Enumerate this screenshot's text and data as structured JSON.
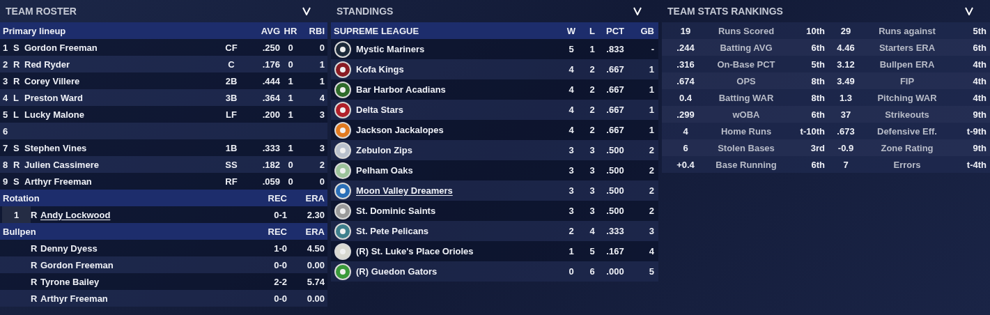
{
  "roster": {
    "title": "TEAM ROSTER",
    "lineup": {
      "heading": "Primary lineup",
      "columns": [
        "AVG",
        "HR",
        "RBI"
      ],
      "batters": [
        {
          "order": "1",
          "bats": "S",
          "name": "Gordon Freeman",
          "position": "CF",
          "avg": ".250",
          "hr": "0",
          "rbi": "0"
        },
        {
          "order": "2",
          "bats": "R",
          "name": "Red Ryder",
          "position": "C",
          "avg": ".176",
          "hr": "0",
          "rbi": "1"
        },
        {
          "order": "3",
          "bats": "R",
          "name": "Corey Villere",
          "position": "2B",
          "avg": ".444",
          "hr": "1",
          "rbi": "1"
        },
        {
          "order": "4",
          "bats": "L",
          "name": "Preston Ward",
          "position": "3B",
          "avg": ".364",
          "hr": "1",
          "rbi": "4"
        },
        {
          "order": "5",
          "bats": "L",
          "name": "Lucky Malone",
          "position": "LF",
          "avg": ".200",
          "hr": "1",
          "rbi": "3"
        },
        {
          "order": "6"
        },
        {
          "order": "7",
          "bats": "S",
          "name": "Stephen Vines",
          "position": "1B",
          "avg": ".333",
          "hr": "1",
          "rbi": "3"
        },
        {
          "order": "8",
          "bats": "R",
          "name": "Julien Cassimere",
          "position": "SS",
          "avg": ".182",
          "hr": "0",
          "rbi": "2"
        },
        {
          "order": "9",
          "bats": "S",
          "name": "Arthyr Freeman",
          "position": "RF",
          "avg": ".059",
          "hr": "0",
          "rbi": "0"
        }
      ]
    },
    "rotation": {
      "heading": "Rotation",
      "columns": [
        "REC",
        "ERA"
      ],
      "pitchers": [
        {
          "slot": "1",
          "throws": "R",
          "name": "Andy Lockwood",
          "record": "0-1",
          "era": "2.30",
          "highlighted": true
        }
      ]
    },
    "bullpen": {
      "heading": "Bullpen",
      "columns": [
        "REC",
        "ERA"
      ],
      "pitchers": [
        {
          "throws": "R",
          "name": "Denny Dyess",
          "record": "1-0",
          "era": "4.50",
          "highlighted": false
        },
        {
          "throws": "R",
          "name": "Gordon Freeman",
          "record": "0-0",
          "era": "0.00",
          "highlighted": false
        },
        {
          "throws": "R",
          "name": "Tyrone Bailey",
          "record": "2-2",
          "era": "5.74",
          "highlighted": false
        },
        {
          "throws": "R",
          "name": "Arthyr Freeman",
          "record": "0-0",
          "era": "0.00",
          "highlighted": false
        }
      ]
    }
  },
  "standings": {
    "title": "STANDINGS",
    "league": "SUPREME LEAGUE",
    "columns": [
      "W",
      "L",
      "PCT",
      "GB"
    ],
    "teams": [
      {
        "name": "Mystic Mariners",
        "w": "5",
        "l": "1",
        "pct": ".833",
        "gb": "-",
        "color": "#1c2a3a",
        "highlighted": false
      },
      {
        "name": "Kofa Kings",
        "w": "4",
        "l": "2",
        "pct": ".667",
        "gb": "1",
        "color": "#8a1c24",
        "highlighted": false
      },
      {
        "name": "Bar Harbor Acadians",
        "w": "4",
        "l": "2",
        "pct": ".667",
        "gb": "1",
        "color": "#2e6b2a",
        "highlighted": false
      },
      {
        "name": "Delta Stars",
        "w": "4",
        "l": "2",
        "pct": ".667",
        "gb": "1",
        "color": "#b0202a",
        "highlighted": false
      },
      {
        "name": "Jackson Jackalopes",
        "w": "4",
        "l": "2",
        "pct": ".667",
        "gb": "1",
        "color": "#e07a20",
        "highlighted": false
      },
      {
        "name": "Zebulon Zips",
        "w": "3",
        "l": "3",
        "pct": ".500",
        "gb": "2",
        "color": "#b8c0cc",
        "highlighted": false
      },
      {
        "name": "Pelham Oaks",
        "w": "3",
        "l": "3",
        "pct": ".500",
        "gb": "2",
        "color": "#9cc29a",
        "highlighted": false
      },
      {
        "name": "Moon Valley Dreamers",
        "w": "3",
        "l": "3",
        "pct": ".500",
        "gb": "2",
        "color": "#2a6fb8",
        "highlighted": true
      },
      {
        "name": "St. Dominic Saints",
        "w": "3",
        "l": "3",
        "pct": ".500",
        "gb": "2",
        "color": "#9a9a9a",
        "highlighted": false
      },
      {
        "name": "St. Pete Pelicans",
        "w": "2",
        "l": "4",
        "pct": ".333",
        "gb": "3",
        "color": "#3e7f8c",
        "highlighted": false
      },
      {
        "name": "(R) St. Luke's Place Orioles",
        "w": "1",
        "l": "5",
        "pct": ".167",
        "gb": "4",
        "color": "#d8d8d0",
        "highlighted": false
      },
      {
        "name": "(R) Guedon Gators",
        "w": "0",
        "l": "6",
        "pct": ".000",
        "gb": "5",
        "color": "#3a9a3a",
        "highlighted": false
      }
    ]
  },
  "rankings": {
    "title": "TEAM STATS RANKINGS",
    "rows": [
      {
        "value_1": "19",
        "stat_1": "Runs Scored",
        "rank_1": "10th",
        "value_2": "29",
        "stat_2": "Runs against",
        "rank_2": "5th"
      },
      {
        "value_1": ".244",
        "stat_1": "Batting AVG",
        "rank_1": "6th",
        "value_2": "4.46",
        "stat_2": "Starters ERA",
        "rank_2": "6th"
      },
      {
        "value_1": ".316",
        "stat_1": "On-Base PCT",
        "rank_1": "5th",
        "value_2": "3.12",
        "stat_2": "Bullpen ERA",
        "rank_2": "4th"
      },
      {
        "value_1": ".674",
        "stat_1": "OPS",
        "rank_1": "8th",
        "value_2": "3.49",
        "stat_2": "FIP",
        "rank_2": "4th"
      },
      {
        "value_1": "0.4",
        "stat_1": "Batting WAR",
        "rank_1": "8th",
        "value_2": "1.3",
        "stat_2": "Pitching WAR",
        "rank_2": "4th"
      },
      {
        "value_1": ".299",
        "stat_1": "wOBA",
        "rank_1": "6th",
        "value_2": "37",
        "stat_2": "Strikeouts",
        "rank_2": "9th"
      },
      {
        "value_1": "4",
        "stat_1": "Home Runs",
        "rank_1": "t-10th",
        "value_2": ".673",
        "stat_2": "Defensive Eff.",
        "rank_2": "t-9th"
      },
      {
        "value_1": "6",
        "stat_1": "Stolen Bases",
        "rank_1": "3rd",
        "value_2": "-0.9",
        "stat_2": "Zone Rating",
        "rank_2": "9th"
      },
      {
        "value_1": "+0.4",
        "stat_1": "Base Running",
        "rank_1": "6th",
        "value_2": "7",
        "stat_2": "Errors",
        "rank_2": "t-4th"
      }
    ]
  }
}
